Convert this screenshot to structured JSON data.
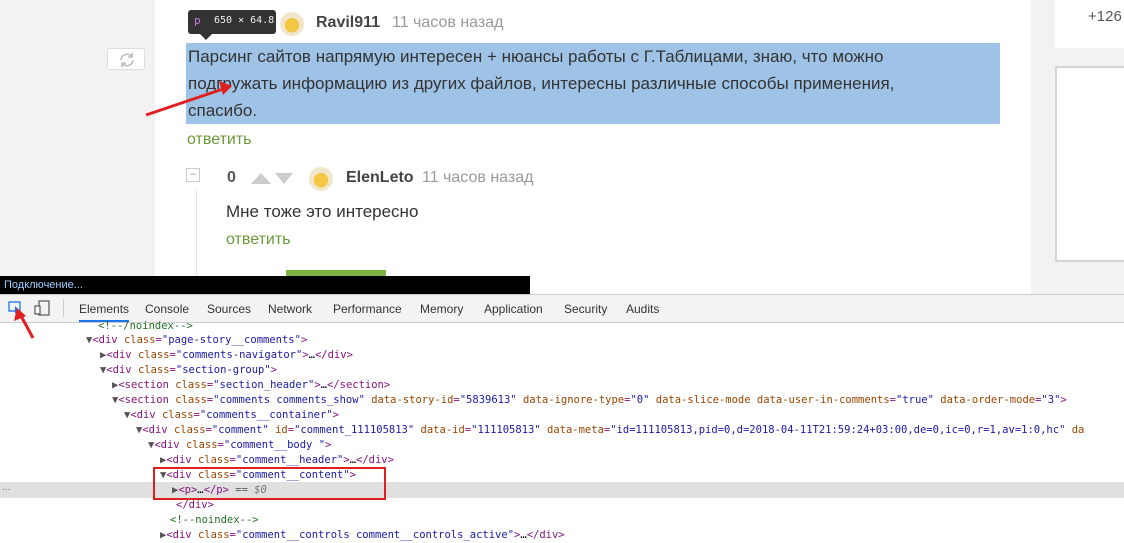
{
  "tooltip": {
    "tag": "p",
    "dimensions": "650 × 64.8"
  },
  "comment1": {
    "username": "Ravil911",
    "time": "11 часов назад",
    "lines": [
      "Парсинг сайтов напрямую интересен + нюансы работы с Г.Таблицами, знаю, что можно",
      "подгружать информацию из других файлов, интересны различные способы применения,",
      "спасибо."
    ],
    "reply": "ответить"
  },
  "comment2": {
    "collapse": "−",
    "rating": "0",
    "username": "ElenLeto",
    "time": "11 часов назад",
    "text": "Мне тоже это интересно",
    "reply": "ответить"
  },
  "sidebar": {
    "count": "+126"
  },
  "status": {
    "connecting": "Подключение..."
  },
  "devtools": {
    "tabs": [
      "Elements",
      "Console",
      "Sources",
      "Network",
      "Performance",
      "Memory",
      "Application",
      "Security",
      "Audits"
    ],
    "ellipsis": "..."
  },
  "colors": {
    "highlight": "#9fc3e6",
    "annotation": "#e02020",
    "reply": "#6a9a38"
  },
  "icons": [
    "refresh-icon",
    "inspect-icon",
    "device-toggle-icon",
    "arrow-up-icon",
    "arrow-down-icon"
  ]
}
